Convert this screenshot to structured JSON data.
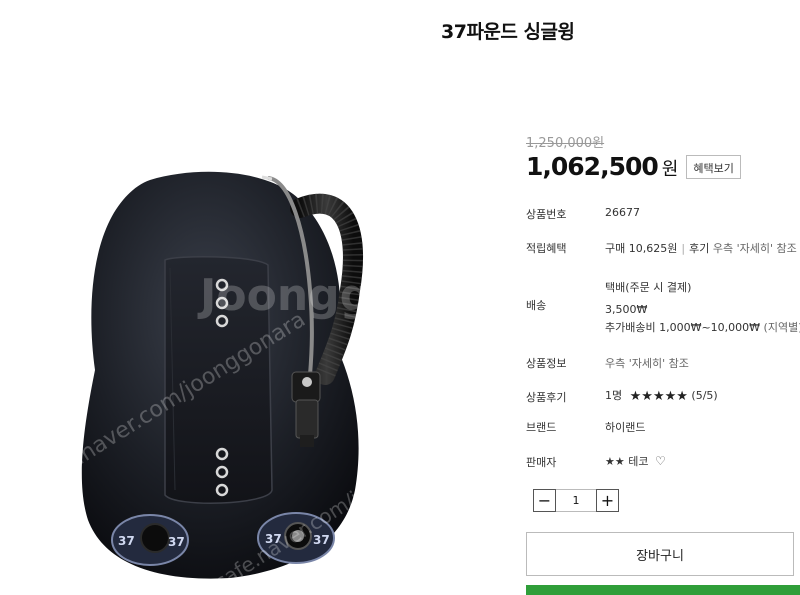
{
  "product": {
    "title": "37파운드 싱글윙",
    "original_price": "1,250,000원",
    "price": "1,062,500",
    "price_unit": "원",
    "benefit_button": "혜택보기"
  },
  "info": {
    "product_number_label": "상품번호",
    "product_number": "26677",
    "points_label": "적립혜택",
    "points_purchase": "구매 10,625원",
    "points_separator": "|",
    "points_review": "후기",
    "points_review_note": "우측 '자세히' 참조",
    "shipping_label": "배송",
    "shipping_method": "택배(주문 시 결제)",
    "shipping_fee": "3,500₩",
    "shipping_extra": "추가배송비 1,000₩~10,000₩",
    "shipping_extra_note": "(지역별)",
    "detail_label": "상품정보",
    "detail_value": "우측 '자세히' 참조",
    "review_label": "상품후기",
    "review_count": "1명",
    "review_score": "(5/5)",
    "review_rating": 5,
    "brand_label": "브랜드",
    "brand_value": "하이랜드",
    "seller_label": "판매자",
    "seller_stars": "★★",
    "seller_name": "테코"
  },
  "quantity": {
    "minus": "−",
    "value": "1",
    "plus": "+"
  },
  "cart_button": "장바구니",
  "icons": {
    "star": "star-icon",
    "heart": "heart-outline-icon"
  },
  "colors": {
    "accent_green": "#2f9e39"
  },
  "image": {
    "watermark_1": "Joonggonara",
    "watermark_2": "cafe.naver.com/joonggonara",
    "logo_text": "37"
  }
}
